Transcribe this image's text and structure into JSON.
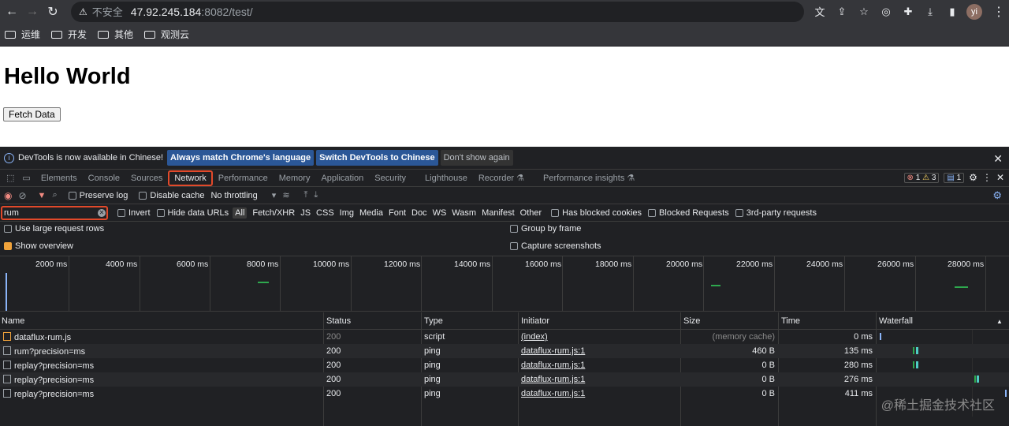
{
  "browser": {
    "security_label": "不安全",
    "url_host": "47.92.245.184",
    "url_path": ":8082/test/",
    "avatar_initials": "yi"
  },
  "bookmarks": [
    "运维",
    "开发",
    "其他",
    "观测云"
  ],
  "page": {
    "heading": "Hello World",
    "button_label": "Fetch Data"
  },
  "devtools": {
    "infobar": {
      "message": "DevTools is now available in Chinese!",
      "btn_match": "Always match Chrome's language",
      "btn_switch": "Switch DevTools to Chinese",
      "btn_dismiss": "Don't show again"
    },
    "tabs": [
      "Elements",
      "Console",
      "Sources",
      "Network",
      "Performance",
      "Memory",
      "Application",
      "Security",
      "Lighthouse",
      "Recorder ⚗",
      "Performance insights ⚗"
    ],
    "active_tab": "Network",
    "badges": {
      "errors": "1",
      "warnings": "3",
      "messages": "1"
    },
    "toolbar": {
      "preserve_log": "Preserve log",
      "disable_cache": "Disable cache",
      "throttling": "No throttling"
    },
    "filter": {
      "value": "rum",
      "invert": "Invert",
      "hide_data_urls": "Hide data URLs",
      "types": [
        "All",
        "Fetch/XHR",
        "JS",
        "CSS",
        "Img",
        "Media",
        "Font",
        "Doc",
        "WS",
        "Wasm",
        "Manifest",
        "Other"
      ],
      "selected_type": "All",
      "blocked_cookies": "Has blocked cookies",
      "blocked_requests": "Blocked Requests",
      "third_party": "3rd-party requests"
    },
    "options": {
      "large_rows": "Use large request rows",
      "show_overview": "Show overview",
      "group_by_frame": "Group by frame",
      "capture_screenshots": "Capture screenshots"
    },
    "overview_ticks": [
      "2000 ms",
      "4000 ms",
      "6000 ms",
      "8000 ms",
      "10000 ms",
      "12000 ms",
      "14000 ms",
      "16000 ms",
      "18000 ms",
      "20000 ms",
      "22000 ms",
      "24000 ms",
      "26000 ms",
      "28000 ms"
    ],
    "columns": [
      "Name",
      "Status",
      "Type",
      "Initiator",
      "Size",
      "Time",
      "Waterfall"
    ],
    "rows": [
      {
        "name": "dataflux-rum.js",
        "status": "200",
        "type": "script",
        "initiator": "(index)",
        "size": "(memory cache)",
        "time": "0 ms"
      },
      {
        "name": "rum?precision=ms",
        "status": "200",
        "type": "ping",
        "initiator": "dataflux-rum.js:1",
        "size": "460 B",
        "time": "135 ms"
      },
      {
        "name": "replay?precision=ms",
        "status": "200",
        "type": "ping",
        "initiator": "dataflux-rum.js:1",
        "size": "0 B",
        "time": "280 ms"
      },
      {
        "name": "replay?precision=ms",
        "status": "200",
        "type": "ping",
        "initiator": "dataflux-rum.js:1",
        "size": "0 B",
        "time": "276 ms"
      },
      {
        "name": "replay?precision=ms",
        "status": "200",
        "type": "ping",
        "initiator": "dataflux-rum.js:1",
        "size": "0 B",
        "time": "411 ms"
      }
    ]
  },
  "watermark": "@稀土掘金技术社区",
  "colors": {
    "accent_highlight": "#e2492a",
    "link_blue": "#2b5797",
    "overview_green": "#2ea84e"
  }
}
